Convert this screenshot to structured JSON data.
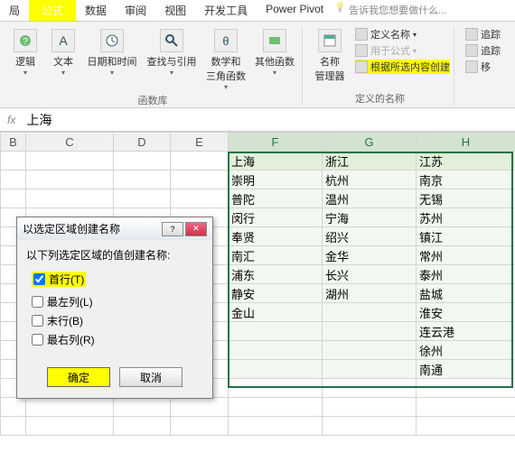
{
  "tabs": {
    "t0": "局",
    "active": "公式",
    "t2": "数据",
    "t3": "审阅",
    "t4": "视图",
    "t5": "开发工具",
    "t6": "Power Pivot",
    "tellme": "告诉我您想要做什么..."
  },
  "ribbon": {
    "funcs_label": "函数库",
    "btn_logic": "逻辑",
    "btn_text": "文本",
    "btn_datetime": "日期和时间",
    "btn_lookup": "查找与引用",
    "btn_mathtrig": "数学和\n三角函数",
    "btn_more": "其他函数",
    "btn_namemgr": "名称\n管理器",
    "defined_label": "定义的名称",
    "define_name": "定义名称",
    "use_in_formula": "用于公式",
    "create_from_selection": "根据所选内容创建",
    "trace1": "追踪",
    "trace2": "追踪",
    "tmore": "移"
  },
  "formula_bar": {
    "value": "上海"
  },
  "grid": {
    "cols": [
      "B",
      "C",
      "D",
      "E",
      "F",
      "G",
      "H"
    ],
    "headers": {
      "F": "上海",
      "G": "浙江",
      "H": "江苏"
    },
    "rows": [
      {
        "F": "崇明",
        "G": "杭州",
        "H": "南京"
      },
      {
        "F": "普陀",
        "G": "温州",
        "H": "无锡"
      },
      {
        "F": "闵行",
        "G": "宁海",
        "H": "苏州"
      },
      {
        "F": "奉贤",
        "G": "绍兴",
        "H": "镇江"
      },
      {
        "F": "南汇",
        "G": "金华",
        "H": "常州"
      },
      {
        "F": "浦东",
        "G": "长兴",
        "H": "泰州"
      },
      {
        "F": "静安",
        "G": "湖州",
        "H": "盐城"
      },
      {
        "F": "金山",
        "G": "",
        "H": "淮安"
      },
      {
        "F": "",
        "G": "",
        "H": "连云港"
      },
      {
        "F": "",
        "G": "",
        "H": "徐州"
      },
      {
        "F": "",
        "G": "",
        "H": "南通"
      }
    ]
  },
  "dialog": {
    "title": "以选定区域创建名称",
    "instruction": "以下列选定区域的值创建名称:",
    "top_row": "首行(T)",
    "left_col": "最左列(L)",
    "bottom_row": "末行(B)",
    "right_col": "最右列(R)",
    "ok": "确定",
    "cancel": "取消"
  }
}
